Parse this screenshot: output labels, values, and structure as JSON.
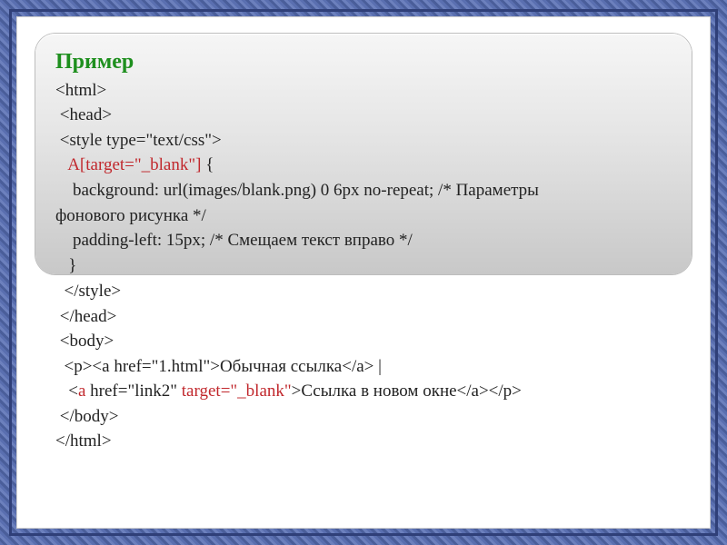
{
  "title": "Пример",
  "code": {
    "l1": "<html>",
    "l2": " <head>",
    "l3": " <style type=\"text/css\">",
    "l4_sel": "   A[target=\"_blank\"]",
    "l4_rest": " {",
    "l5": "    background: url(images/blank.png) 0 6px no-repeat; /* Параметры",
    "l6": "фонового рисунка */",
    "l7": "    padding-left: 15px; /* Смещаем текст вправо */",
    "l8": "   }",
    "l9": "  </style>",
    "l10": " </head>",
    "l11": " <body>",
    "l12": "  <p><a href=\"1.html\">Обычная ссылка</a> | ",
    "l13_a": "   <",
    "l13_tag": "a",
    "l13_b": " href=\"link2\" ",
    "l13_attr": "target=\"_blank\"",
    "l13_c": ">Ссылка в новом окне</a></p>",
    "l14": " </body>",
    "l15": "</html>"
  }
}
